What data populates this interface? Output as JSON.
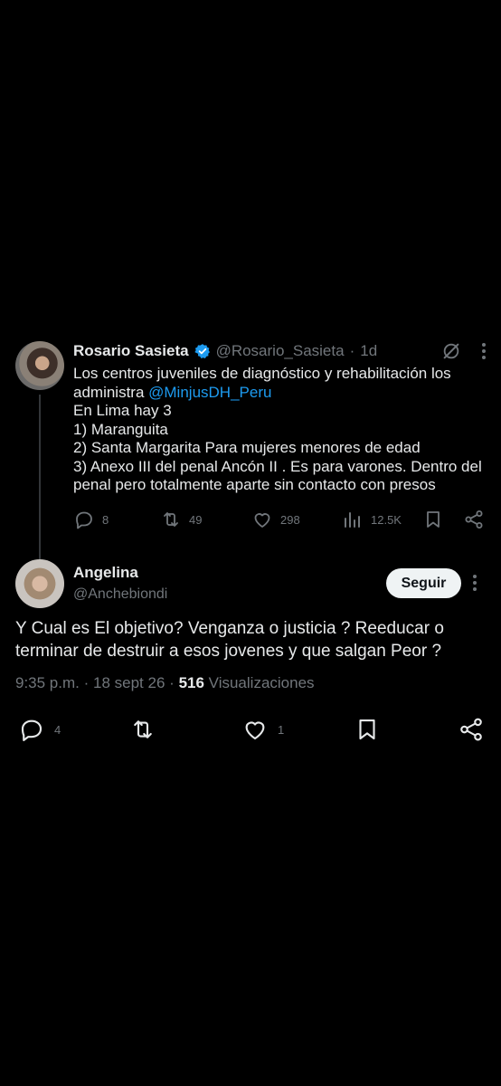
{
  "tweet1": {
    "author_name": "Rosario Sasieta",
    "handle": "@Rosario_Sasieta",
    "separator": "·",
    "time": "1d",
    "body_lines_before_mention": "Los centros juveniles de diagnóstico y rehabilitación los",
    "body_line2_prefix": "administra ",
    "mention": "@MinjusDH_Peru",
    "body_lines": [
      "En Lima hay 3",
      "1) Maranguita",
      "2) Santa Margarita Para mujeres menores de edad",
      "3) Anexo III del penal Ancón II . Es para varones. Dentro del",
      "penal pero totalmente aparte sin contacto con presos"
    ],
    "replies": "8",
    "retweets": "49",
    "likes": "298",
    "views": "12.5K"
  },
  "tweet2": {
    "author_name": "Angelina",
    "handle": "@Anchebiondi",
    "follow_label": "Seguir",
    "body_lines": [
      "Y Cual es El objetivo? Venganza o justicia ? Reeducar o",
      "terminar de destruir a esos jovenes y que salgan Peor ?"
    ],
    "time": "9:35 p.m.",
    "dot": "·",
    "date": "18 sept 26",
    "views_count": "516",
    "views_label": "Visualizaciones",
    "replies": "4",
    "likes": "1"
  },
  "icons": {
    "verified": "verified-badge-icon",
    "grok": "grok-icon",
    "more": "more-vertical-icon",
    "reply": "reply-icon",
    "retweet": "retweet-icon",
    "like": "heart-icon",
    "views": "views-chart-icon",
    "bookmark": "bookmark-icon",
    "share": "share-icon"
  },
  "colors": {
    "background": "#000000",
    "text": "#e7e9ea",
    "muted": "#71767b",
    "link": "#1d9bf0",
    "follow_bg": "#eff3f4"
  }
}
